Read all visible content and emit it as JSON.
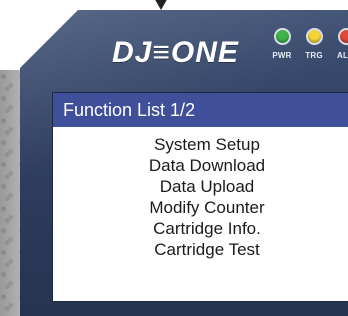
{
  "device": {
    "brand": "DJ≡ONE"
  },
  "leds": [
    {
      "label": "PWR",
      "color": "#3db34a"
    },
    {
      "label": "TRG",
      "color": "#f2d43a"
    },
    {
      "label": "ALM",
      "color": "#e2473b"
    }
  ],
  "screen": {
    "title": "Function List 1/2",
    "items": [
      "System Setup",
      "Data Download",
      "Data Upload",
      "Modify Counter",
      "Cartridge Info.",
      "Cartridge Test"
    ]
  }
}
